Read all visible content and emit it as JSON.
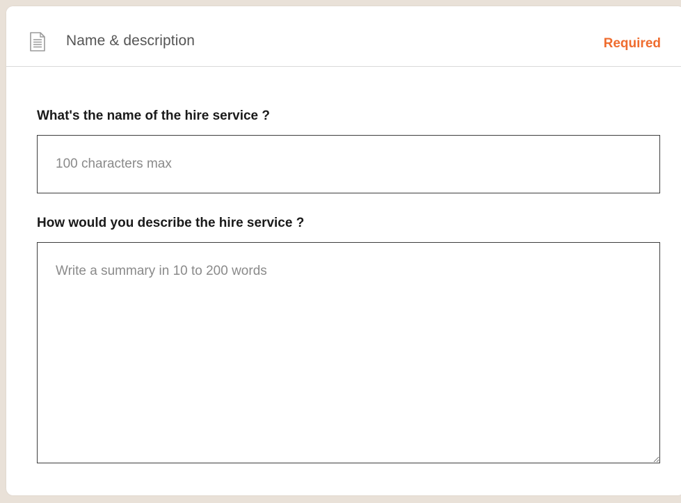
{
  "colors": {
    "required": "#ef6c2e",
    "page_background": "#e9e1d8",
    "card_background": "#ffffff"
  },
  "header": {
    "icon": "document-icon",
    "title": "Name & description",
    "required_label": "Required"
  },
  "form": {
    "name_question": "What's the name of the hire service ?",
    "name_placeholder": "100 characters max",
    "name_value": "",
    "description_question": "How would you describe the hire service ?",
    "description_placeholder": "Write a summary in 10 to 200 words",
    "description_value": ""
  }
}
